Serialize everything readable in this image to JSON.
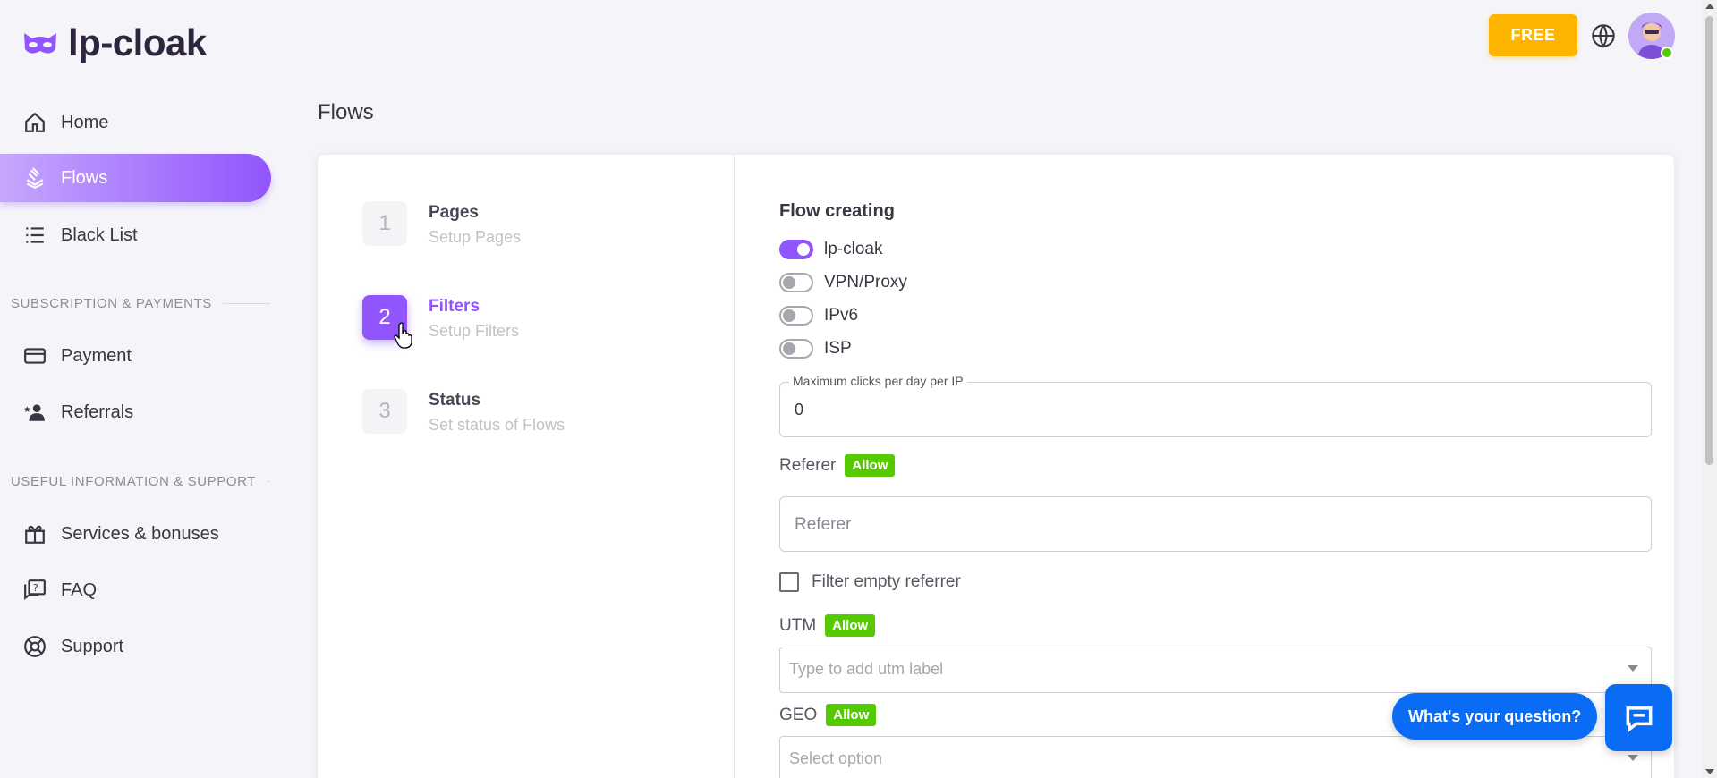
{
  "app": {
    "logo_text": "lp-cloak"
  },
  "sidebar": {
    "items": [
      {
        "label": "Home",
        "icon": "home-icon"
      },
      {
        "label": "Flows",
        "icon": "layers-icon",
        "active": true
      },
      {
        "label": "Black List",
        "icon": "list-icon"
      }
    ],
    "section_subscription": "SUBSCRIPTION & PAYMENTS",
    "subscription_items": [
      {
        "label": "Payment",
        "icon": "credit-card-icon"
      },
      {
        "label": "Referrals",
        "icon": "user-star-icon"
      }
    ],
    "section_info": "USEFUL INFORMATION & SUPPORT",
    "info_items": [
      {
        "label": "Services & bonuses",
        "icon": "gift-icon"
      },
      {
        "label": "FAQ",
        "icon": "faq-icon"
      },
      {
        "label": "Support",
        "icon": "lifebuoy-icon"
      }
    ]
  },
  "topbar": {
    "plan_label": "FREE"
  },
  "page": {
    "title": "Flows"
  },
  "steps": [
    {
      "number": "1",
      "title": "Pages",
      "subtitle": "Setup Pages"
    },
    {
      "number": "2",
      "title": "Filters",
      "subtitle": "Setup Filters",
      "active": true
    },
    {
      "number": "3",
      "title": "Status",
      "subtitle": "Set status of Flows"
    }
  ],
  "form": {
    "title": "Flow creating",
    "toggles": [
      {
        "label": "lp-cloak",
        "on": true
      },
      {
        "label": "VPN/Proxy",
        "on": false
      },
      {
        "label": "IPv6",
        "on": false
      },
      {
        "label": "ISP",
        "on": false
      }
    ],
    "max_clicks": {
      "label": "Maximum clicks per day per IP",
      "value": "0"
    },
    "referer": {
      "label": "Referer",
      "badge": "Allow",
      "placeholder": "Referer"
    },
    "filter_empty_referrer": {
      "label": "Filter empty referrer",
      "checked": false
    },
    "utm": {
      "label": "UTM",
      "badge": "Allow",
      "placeholder": "Type to add utm label"
    },
    "geo": {
      "label": "GEO",
      "badge": "Allow",
      "placeholder": "Select option"
    }
  },
  "chat": {
    "prompt": "What's your question?"
  },
  "colors": {
    "primary": "#9155fd",
    "warning": "#ffb400",
    "success": "#56ca00",
    "chat": "#0a6cf5"
  }
}
